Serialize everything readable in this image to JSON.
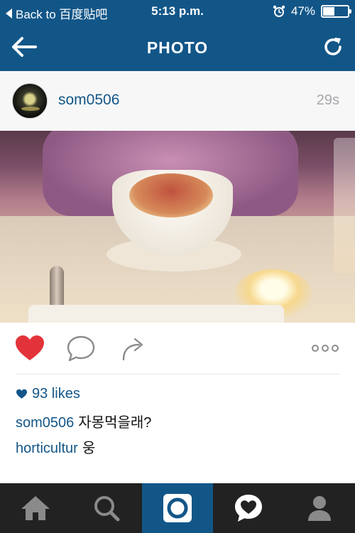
{
  "status_bar": {
    "back_label": "Back to 百度贴吧",
    "time": "5:13 p.m.",
    "battery": "47%",
    "battery_level": 0.47
  },
  "nav": {
    "title": "PHOTO",
    "back_icon": "back-arrow-icon",
    "refresh_icon": "refresh-icon"
  },
  "post": {
    "username": "som0506",
    "time_ago": "29s"
  },
  "actions": {
    "like_icon": "heart-icon",
    "comment_icon": "comment-icon",
    "share_icon": "share-icon",
    "more_icon": "more-icon"
  },
  "likes": {
    "text": "93 likes"
  },
  "comments": [
    {
      "user": "som0506",
      "text": "자몽먹을래?"
    },
    {
      "user": "horticultur",
      "text": "웅"
    }
  ],
  "tabs": [
    {
      "name": "home",
      "icon": "home-icon"
    },
    {
      "name": "search",
      "icon": "search-icon"
    },
    {
      "name": "camera",
      "icon": "camera-icon"
    },
    {
      "name": "activity",
      "icon": "activity-heart-icon"
    },
    {
      "name": "profile",
      "icon": "profile-icon"
    }
  ],
  "colors": {
    "brand": "#125688",
    "like": "#e3333a",
    "tab_bar": "#222222"
  }
}
